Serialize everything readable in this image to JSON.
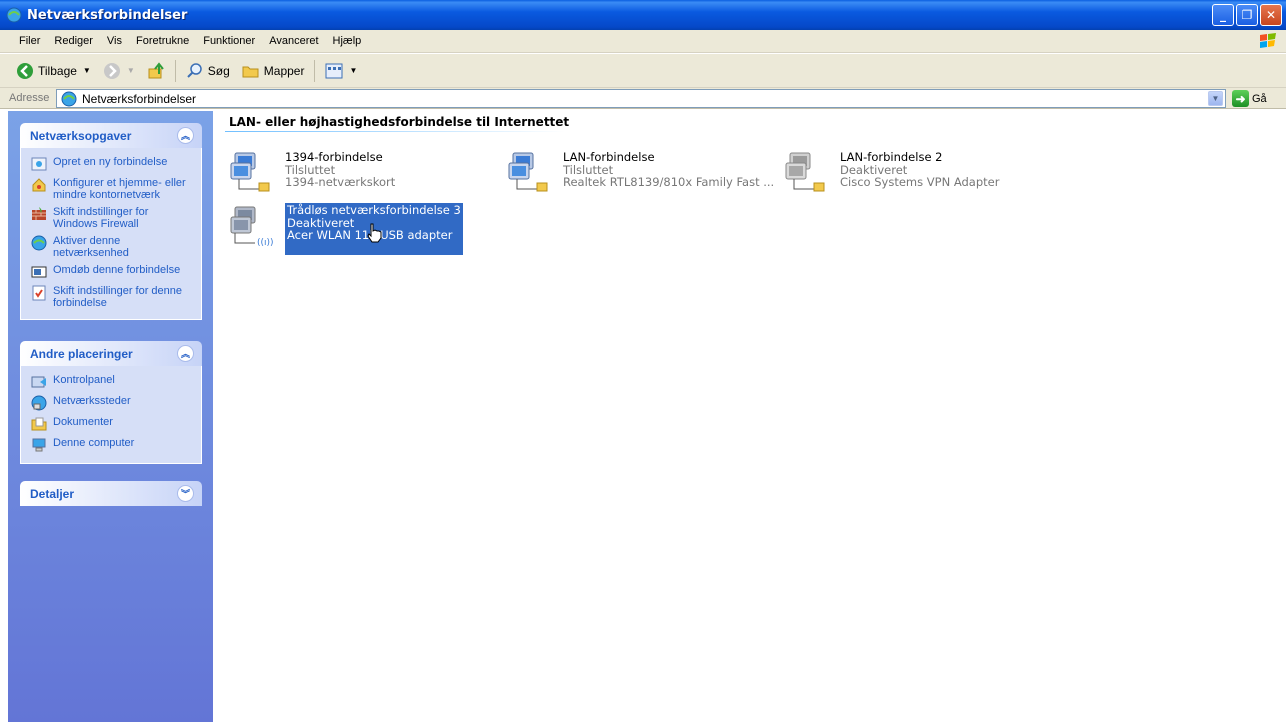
{
  "window": {
    "title": "Netværksforbindelser"
  },
  "menubar": {
    "items": [
      "Filer",
      "Rediger",
      "Vis",
      "Foretrukne",
      "Funktioner",
      "Avanceret",
      "Hjælp"
    ]
  },
  "toolbar": {
    "back_label": "Tilbage",
    "search_label": "Søg",
    "folders_label": "Mapper"
  },
  "address": {
    "label": "Adresse",
    "value": "Netværksforbindelser",
    "go_label": "Gå"
  },
  "sidebar": {
    "network_tasks": {
      "title": "Netværksopgaver",
      "items": [
        "Opret en ny forbindelse",
        "Konfigurer et hjemme- eller mindre kontornetværk",
        "Skift indstillinger for Windows Firewall",
        "Aktiver denne netværksenhed",
        "Omdøb denne forbindelse",
        "Skift indstillinger for denne forbindelse"
      ]
    },
    "other_places": {
      "title": "Andre placeringer",
      "items": [
        "Kontrolpanel",
        "Netværkssteder",
        "Dokumenter",
        "Denne computer"
      ]
    },
    "details": {
      "title": "Detaljer"
    }
  },
  "main": {
    "group_title": "LAN- eller højhastighedsforbindelse til Internettet",
    "connections": [
      {
        "name": "1394-forbindelse",
        "status": "Tilsluttet",
        "device": "1394-netværkskort"
      },
      {
        "name": "LAN-forbindelse",
        "status": "Tilsluttet",
        "device": "Realtek RTL8139/810x Family Fast ..."
      },
      {
        "name": "LAN-forbindelse 2",
        "status": "Deaktiveret",
        "device": "Cisco Systems VPN Adapter"
      },
      {
        "name": "Trådløs netværksforbindelse 3",
        "status": "Deaktiveret",
        "device": "Acer WLAN 11b USB adapter"
      }
    ]
  },
  "colors": {
    "titlebar": "#0a5ae0",
    "taskpane": "#6f8fe0",
    "selection": "#316ac5",
    "link": "#215dc6"
  }
}
